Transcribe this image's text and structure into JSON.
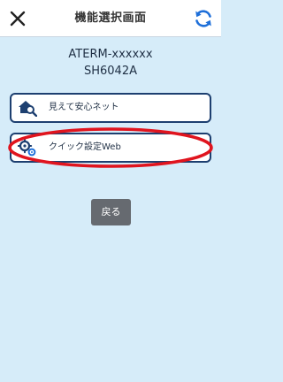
{
  "header": {
    "title": "機能選択画面",
    "close_icon": "close-icon",
    "refresh_icon": "refresh-icon"
  },
  "device": {
    "name": "ATERM-xxxxxx",
    "model": "SH6042A"
  },
  "menu": {
    "items": [
      {
        "label": "見えて安心ネット",
        "icon": "house-search-icon"
      },
      {
        "label": "クイック設定Web",
        "icon": "gears-icon"
      }
    ]
  },
  "back_label": "戻る",
  "colors": {
    "background": "#d6ecf9",
    "header_bg": "#ffffff",
    "accent": "#1e6fd9",
    "button_border": "#1d3f70",
    "highlight": "#e0141e",
    "back_button": "#666a70"
  }
}
